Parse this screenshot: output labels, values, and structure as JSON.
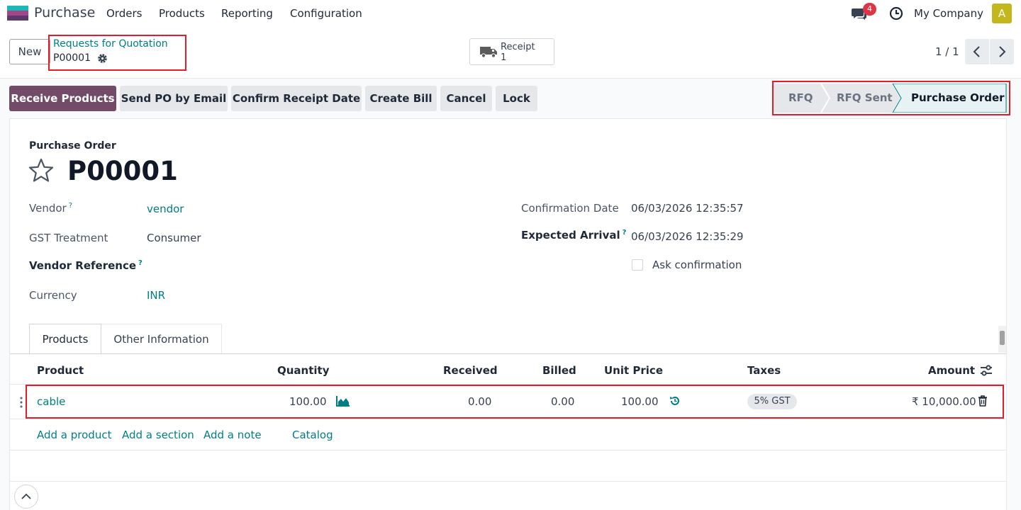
{
  "navbar": {
    "app_name": "Purchase",
    "menu": [
      "Orders",
      "Products",
      "Reporting",
      "Configuration"
    ],
    "message_count": "4",
    "company": "My Company",
    "avatar_letter": "A"
  },
  "breadcrumb": {
    "parent": "Requests for Quotation",
    "current": "P00001"
  },
  "control": {
    "new_label": "New",
    "receipt_label": "Receipt",
    "receipt_count": "1",
    "pager": "1 / 1"
  },
  "actions": [
    "Receive Products",
    "Send PO by Email",
    "Confirm Receipt Date",
    "Create Bill",
    "Cancel",
    "Lock"
  ],
  "status": {
    "stages": [
      "RFQ",
      "RFQ Sent",
      "Purchase Order"
    ],
    "current": "Purchase Order"
  },
  "form": {
    "title_label": "Purchase Order",
    "record_name": "P00001",
    "vendor_label": "Vendor",
    "vendor_value": "vendor",
    "gst_label": "GST Treatment",
    "gst_value": "Consumer",
    "vendor_ref_label": "Vendor Reference",
    "currency_label": "Currency",
    "currency_value": "INR",
    "confirmation_label": "Confirmation Date",
    "confirmation_value": "06/03/2026 12:35:57",
    "expected_label": "Expected Arrival",
    "expected_value": "06/03/2026 12:35:29",
    "ask_confirmation_label": "Ask confirmation",
    "help_mark": "?"
  },
  "tabs": [
    "Products",
    "Other Information"
  ],
  "table": {
    "headers": [
      "Product",
      "Quantity",
      "Received",
      "Billed",
      "Unit Price",
      "Taxes",
      "Amount"
    ],
    "rows": [
      {
        "product": "cable",
        "quantity": "100.00",
        "received": "0.00",
        "billed": "0.00",
        "unit_price": "100.00",
        "tax": "5% GST",
        "amount": "₹ 10,000.00"
      }
    ],
    "add_links": [
      "Add a product",
      "Add a section",
      "Add a note",
      "Catalog"
    ]
  },
  "colors": {
    "primary": "#714b67",
    "link": "#017e84",
    "highlight": "#e11d2a"
  }
}
